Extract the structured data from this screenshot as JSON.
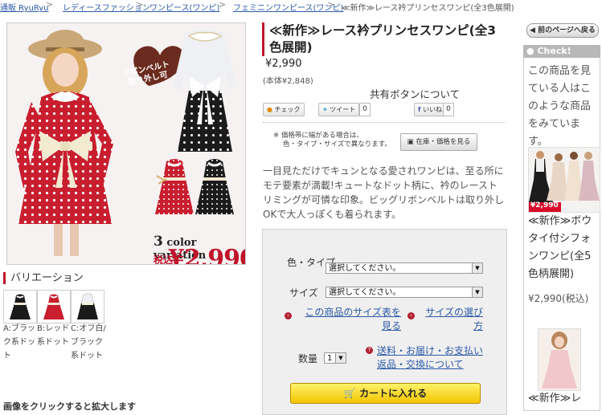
{
  "breadcrumb": {
    "items": [
      "通販 RyuRyu",
      "レディースファッション",
      "ワンピース(ワンピ)",
      "フェミニンワンピース(ワンピ)"
    ],
    "current": "≪新作≫レース衿プリンセスワンピ(全3色展開)",
    "separator": ">"
  },
  "hero": {
    "badge": "リボンベルト取り外し可",
    "variation_count": "3",
    "variation_text": "color variation",
    "tax_label": "税込",
    "price": "¥2,990"
  },
  "variations": {
    "title": "バリエーション",
    "items": [
      {
        "label": "A:ブラック系ドット",
        "color": "#1a1a1a"
      },
      {
        "label": "B:レッド系ドット",
        "color": "#c81e2e"
      },
      {
        "label": "C:オフ白/ブラック系ドット",
        "color": "#f2f2ee"
      }
    ]
  },
  "bottom_text": "画像をクリックすると拡大します",
  "product": {
    "title": "≪新作≫レース衿プリンセスワンピ(全3色展開)",
    "price": "¥2,990",
    "price_note": "(本体¥2,848)",
    "share_link": "共有ボタンについて",
    "check_label": "チェック",
    "check_count": "",
    "tweet_label": "ツイート",
    "tweet_count": "0",
    "like_label": "いいね!",
    "like_count": "0",
    "note_mark": "※",
    "note_line1": "価格帯に幅がある場合は、",
    "note_line2": "色・タイプ・サイズで異なります。",
    "stock_button": "在庫・価格を見る",
    "description": "一目見ただけでキュンとなる愛されワンピは、至る所にモテ要素が満載!キュートなドット柄に、衿のレーストリミングが可憐な印象。ビッグリボンベルトは取り外しOKで大人っぽくも着られます。"
  },
  "order": {
    "color_label": "色・タイプ",
    "color_select": "選択してください。",
    "size_label": "サイズ",
    "size_select": "選択してください。",
    "size_table_link_1": "この商品のサイズ表を",
    "size_table_link_2": "見る",
    "size_guide_link_1": "サイズの選び",
    "size_guide_link_2": "方",
    "qty_label": "数量",
    "qty_value": "1",
    "shipping_link_1": "送料・お届け・お支払い",
    "shipping_link_2": "返品・交換について",
    "cart_button": "カートに入れる"
  },
  "sidebar": {
    "back_button": "前のページへ戻る",
    "check_title": "Check!",
    "intro": "この商品を見ている人はこのような商品をみています。",
    "rec1": {
      "title": "≪新作≫ボウタイ付シフォンワンピ(全5色柄展開)",
      "price": "¥2,990(税込)",
      "badge_price": "¥2,990"
    },
    "rec2": {
      "title": "≪新作≫レ"
    }
  },
  "colors": {
    "accent": "#c0142b",
    "link": "#2a5aa8",
    "dress_red": "#c81e2e",
    "cart_yellow": "#f7d700"
  }
}
